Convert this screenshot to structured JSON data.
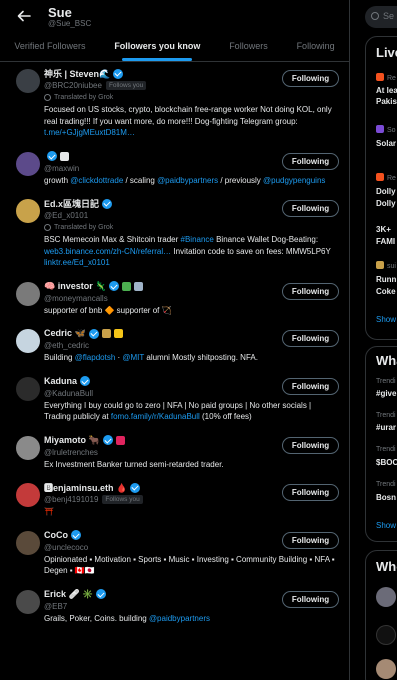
{
  "header": {
    "title": "Sue",
    "handle": "@Sue_BSC"
  },
  "tabs": [
    {
      "label": "Verified Followers"
    },
    {
      "label": "Followers you know"
    },
    {
      "label": "Followers"
    },
    {
      "label": "Following"
    }
  ],
  "active_tab": 1,
  "follow_label": "Following",
  "follows_you_label": "Follows you",
  "translated_label": "Translated by Grok",
  "colors": {
    "accent": "#1d9bf0",
    "background": "#000000",
    "muted": "#71767b"
  },
  "users": [
    {
      "name": "神乐 | Steven🌊",
      "handle": "@BRC20niubee",
      "follows_you": true,
      "translated": true,
      "bio": [
        {
          "t": "Focused on US stocks, crypto, blockchain free-range worker Not doing KOL, only real trading!!! If you want more, do more!!! Dog-fighting Telegram group: "
        },
        {
          "t": "t.me/+GJjgMEuxtD81M…",
          "link": true
        }
      ]
    },
    {
      "name": "",
      "handle": "@maxwin",
      "follows_you": false,
      "translated": false,
      "bio": [
        {
          "t": "growth "
        },
        {
          "t": "@clickdottrade",
          "link": true
        },
        {
          "t": " / scaling "
        },
        {
          "t": "@paidbypartners",
          "link": true
        },
        {
          "t": " / previously "
        },
        {
          "t": "@pudgypenguins",
          "link": true
        }
      ]
    },
    {
      "name": "Ed.x區塊日記",
      "handle": "@Ed_x0101",
      "follows_you": false,
      "translated": true,
      "bio": [
        {
          "t": "BSC Memecoin Max & Shitcoin trader "
        },
        {
          "t": "#Binance",
          "link": true
        },
        {
          "t": " Binance Wallet Dog-Beating: "
        },
        {
          "t": "web3.binance.com/zh-CN/referral…",
          "link": true
        },
        {
          "t": " Invitation code to save on fees: MMW5LP6Y "
        },
        {
          "t": "linktr.ee/Ed_x0101",
          "link": true
        }
      ]
    },
    {
      "name": "🧠 investor 🦎",
      "handle": "@moneymancalls",
      "follows_you": false,
      "translated": false,
      "bio": [
        {
          "t": "supporter of bnb 🔶 supporter of 🏹"
        }
      ]
    },
    {
      "name": "Cedric 🦋",
      "handle": "@eth_cedric",
      "follows_you": false,
      "translated": false,
      "bio": [
        {
          "t": "Building "
        },
        {
          "t": "@flapdotsh",
          "link": true
        },
        {
          "t": " · "
        },
        {
          "t": "@MIT",
          "link": true
        },
        {
          "t": " alumni Mostly shitposting. NFA."
        }
      ]
    },
    {
      "name": "Kaduna",
      "handle": "@KadunaBull",
      "follows_you": false,
      "translated": false,
      "bio": [
        {
          "t": "Everything I buy could go to zero | NFA | No paid groups | No other socials | Trading publicly at "
        },
        {
          "t": "fomo.family/r/KadunaBull",
          "link": true
        },
        {
          "t": " (10% off fees)"
        }
      ]
    },
    {
      "name": "Miyamoto 🐂",
      "handle": "@lruletrenches",
      "follows_you": false,
      "translated": false,
      "bio": [
        {
          "t": "Ex Investment Banker turned semi-retarded trader."
        }
      ]
    },
    {
      "name": "🅱enjaminsu.eth 🩸",
      "handle": "@benj4191019",
      "follows_you": true,
      "translated": false,
      "bio": [
        {
          "t": "⛩️"
        }
      ]
    },
    {
      "name": "CoCo",
      "handle": "@unclecoco",
      "follows_you": false,
      "translated": false,
      "bio": [
        {
          "t": "Opinionated ▪ Motivation ▪ Sports ▪ Music ▪ Investing ▪ Community Building ▪ NFA ▪ Degen ▪ 🇨🇦🇯🇵"
        }
      ]
    },
    {
      "name": "Erick 🩹 ✳️",
      "handle": "@EB7",
      "follows_you": false,
      "translated": false,
      "bio": [
        {
          "t": "Grails, Poker, Coins. building "
        },
        {
          "t": "@paidbypartners",
          "link": true
        }
      ]
    }
  ],
  "sidebar": {
    "search_placeholder": "Se",
    "live_title": "Live",
    "live_items": [
      {
        "lines": [
          "Re",
          "At lea",
          "Pakis"
        ]
      },
      {
        "lines": [
          "So",
          "Solar"
        ]
      },
      {
        "lines": [
          "Re",
          "Dolly",
          "Dolly"
        ]
      },
      {
        "lines": [
          "3K+",
          "FAMI"
        ]
      },
      {
        "lines": [
          "sui",
          "Runn",
          "Coke"
        ]
      }
    ],
    "live_show_more": "Show",
    "happening_title": "Wha",
    "trends": [
      {
        "meta": "Trendi",
        "label": "#give"
      },
      {
        "meta": "Trendi",
        "label": "#urar"
      },
      {
        "meta": "Trendi",
        "label": "$BOO"
      },
      {
        "meta": "Trendi",
        "label": "Bosn"
      }
    ],
    "trends_show_more": "Show",
    "who_title": "Who"
  }
}
